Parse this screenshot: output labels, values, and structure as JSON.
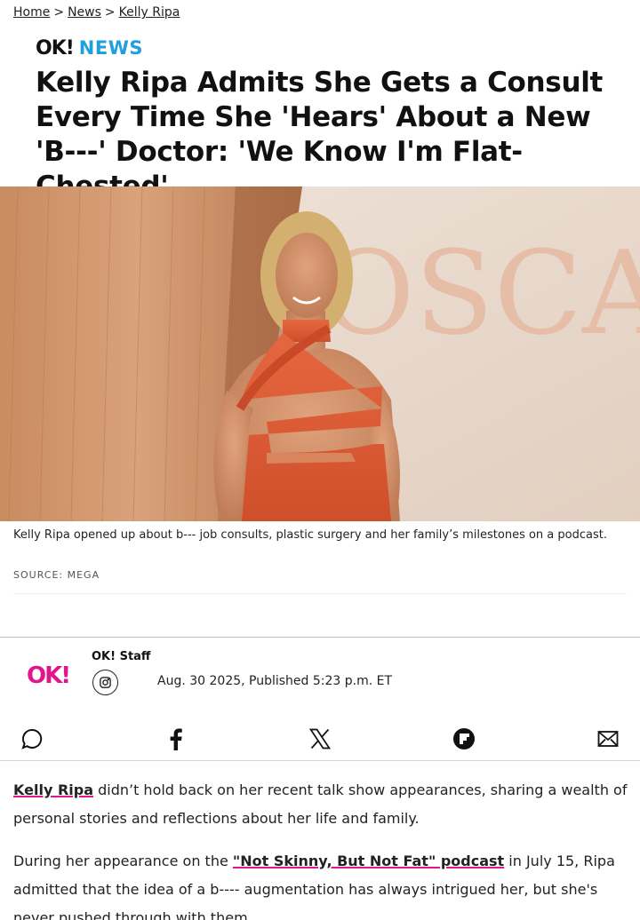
{
  "breadcrumb": {
    "items": [
      "Home",
      "News",
      "Kelly Ripa"
    ],
    "separator": ">"
  },
  "brand": {
    "ok": "OK!",
    "news": "NEWS",
    "news_color": "#1e9fe0"
  },
  "headline": "Kelly Ripa Admits She Gets a Consult Every Time She 'Hears' About a New 'B---' Doctor: 'We Know I'm Flat-Chested'",
  "hero": {
    "image": "woman-in-orange-dress-at-oscars-photo",
    "backdrop_text": "OSCA"
  },
  "caption": "Kelly Ripa opened up about b--- job consults, plastic surgery and her family’s milestones on a podcast.",
  "source": "SOURCE: MEGA",
  "author": {
    "logo": "OK!",
    "logo_color": "#e0168a",
    "name": "OK! Staff",
    "social_icon": "instagram-icon",
    "date": "Aug. 30 2025, Published 5:23 p.m. ET"
  },
  "share_icons": [
    "comment-icon",
    "facebook-icon",
    "x-icon",
    "flipboard-icon",
    "email-icon"
  ],
  "article": {
    "p1_link": "Kelly Ripa",
    "p1_text": " didn’t hold back on her recent talk show appearances, sharing a wealth of personal stories and reflections about her life and family.",
    "p2_pre": "During her appearance on the ",
    "p2_link": "\"Not Skinny, But Not Fat\" podcast",
    "p2_post": " in July 15, Ripa admitted that the idea of a b---- augmentation has always intrigued her, but she's never pushed through with them."
  }
}
